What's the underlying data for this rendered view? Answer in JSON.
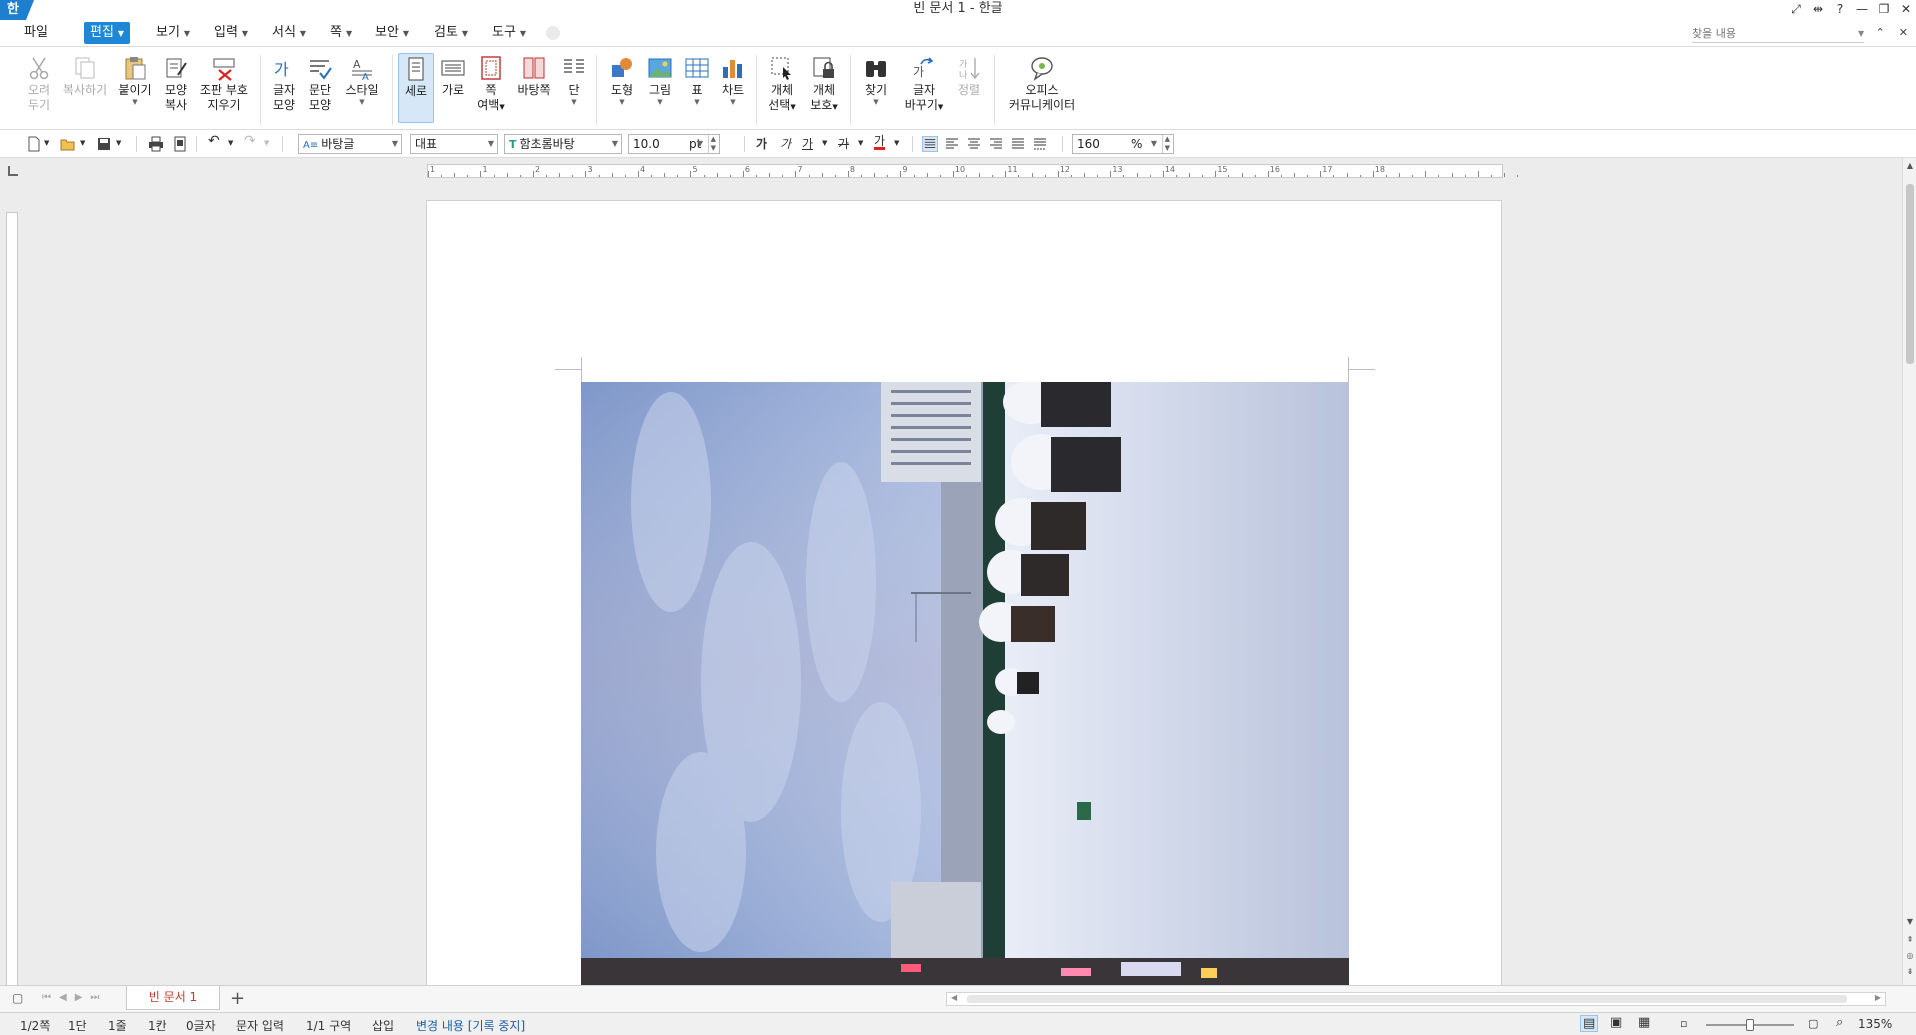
{
  "app": {
    "logo": "한",
    "title": "빈 문서 1 - 한글"
  },
  "menu": {
    "file": "파일",
    "edit": "편집",
    "view": "보기",
    "input": "입력",
    "format": "서식",
    "page": "쪽",
    "security": "보안",
    "review": "검토",
    "tools": "도구"
  },
  "search": {
    "placeholder": "찾을 내용"
  },
  "ribbon": {
    "cut": [
      "오려",
      "두기"
    ],
    "copy": "복사하기",
    "paste": "붙이기",
    "format_copy": [
      "모양",
      "복사"
    ],
    "clear_marks": [
      "조판 부호",
      "지우기"
    ],
    "char_shape": [
      "글자",
      "모양"
    ],
    "para_shape": [
      "문단",
      "모양"
    ],
    "style": "스타일",
    "portrait": "세로",
    "landscape": "가로",
    "page_margin": [
      "쪽",
      "여백"
    ],
    "background": "바탕쪽",
    "columns": "단",
    "shape": "도형",
    "picture": "그림",
    "table": "표",
    "chart": "차트",
    "object_select": [
      "개체",
      "선택"
    ],
    "object_protect": [
      "개체",
      "보호"
    ],
    "find": "찾기",
    "replace": [
      "글자",
      "바꾸기"
    ],
    "sort": "정렬",
    "office_messenger": [
      "오피스",
      "커뮤니케이터"
    ]
  },
  "formatbar": {
    "style": "바탕글",
    "lang": "대표",
    "font": "함초롬바탕",
    "size": "10.0",
    "unit": "pt",
    "bold": "가",
    "italic": "가",
    "underline": "가",
    "strike": "가",
    "color": "가",
    "line_spacing": "160",
    "percent": "%"
  },
  "ruler": {
    "h_numbers": [
      "1",
      "1",
      "2",
      "3",
      "4",
      "5",
      "6",
      "7",
      "8",
      "9",
      "10",
      "11",
      "12",
      "13",
      "14",
      "15",
      "16",
      "17",
      "18"
    ]
  },
  "tabs": {
    "doc": "빈 문서 1",
    "add": "+"
  },
  "status": {
    "page": "1/2쪽",
    "column": "1단",
    "line": "1줄",
    "col": "1칸",
    "chars": "0글자",
    "mode": "문자 입력",
    "section": "1/1 구역",
    "insert": "삽입",
    "track": "변경 내용 [기록 중지]",
    "zoom": "135%"
  },
  "colors": {
    "accent": "#1e88d6",
    "tab_text": "#c0392b",
    "track": "#1a5ea8"
  }
}
